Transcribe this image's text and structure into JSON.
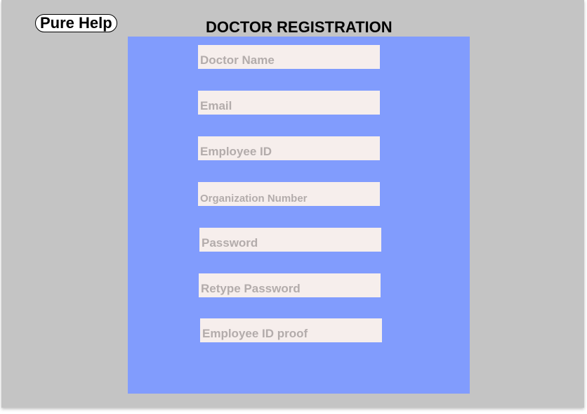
{
  "header": {
    "logo_text": "Pure Help",
    "page_title": "DOCTOR REGISTRATION"
  },
  "form": {
    "fields": [
      {
        "placeholder": "Doctor Name"
      },
      {
        "placeholder": "Email"
      },
      {
        "placeholder": "Employee ID"
      },
      {
        "placeholder": "Organization Number"
      },
      {
        "placeholder": "Password"
      },
      {
        "placeholder": "Retype Password"
      },
      {
        "placeholder": "Employee ID proof"
      }
    ]
  },
  "colors": {
    "background": "#c4c4c4",
    "panel": "#819cfd",
    "field": "#f6eeec",
    "placeholder_text": "#b3acab"
  }
}
